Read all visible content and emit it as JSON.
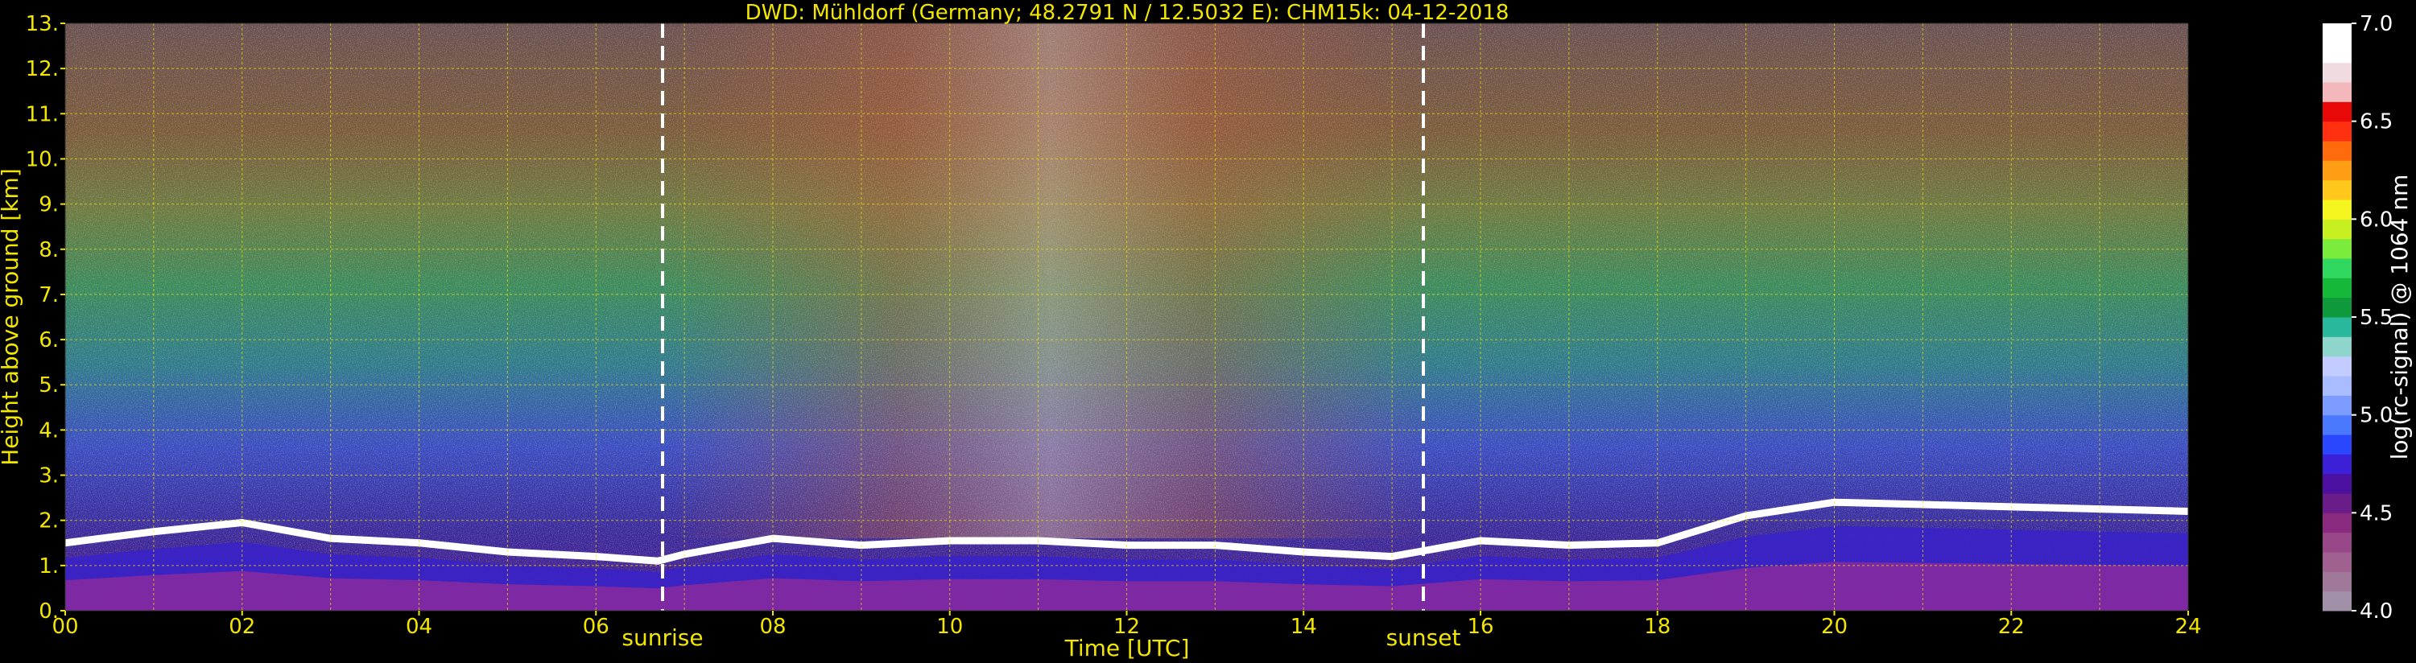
{
  "chart_data": {
    "type": "heatmap",
    "title": "DWD: Mühldorf (Germany; 48.2791 N / 12.5032 E):    CHM15k: 04-12-2018",
    "xlabel": "Time [UTC]",
    "ylabel": "Height above ground [km]",
    "xlim": [
      0,
      24
    ],
    "ylim": [
      0,
      13
    ],
    "x_ticks": [
      "00",
      "02",
      "04",
      "06",
      "08",
      "10",
      "12",
      "14",
      "16",
      "18",
      "20",
      "22",
      "24"
    ],
    "y_ticks": [
      "0.",
      "1.",
      "2.",
      "3.",
      "4.",
      "5.",
      "6.",
      "7.",
      "8.",
      "9.",
      "10.",
      "11.",
      "12.",
      "13."
    ],
    "grid": true,
    "annotations": [
      {
        "label": "sunrise",
        "time": 6.75
      },
      {
        "label": "sunset",
        "time": 15.3
      }
    ],
    "colorbar": {
      "label": "log(rc-signal) @ 1064 nm",
      "range": [
        4.0,
        7.0
      ],
      "ticks": [
        "4.0",
        "4.5",
        "5.0",
        "5.5",
        "6.0",
        "6.5",
        "7.0"
      ],
      "colors": [
        "#a090a8",
        "#a07898",
        "#a06090",
        "#984888",
        "#8a2a7e",
        "#6a1c88",
        "#4c10a0",
        "#3c20d8",
        "#2a46ff",
        "#4a78ff",
        "#7c9cff",
        "#a8bcff",
        "#c2ccff",
        "#8ed6cc",
        "#2ab89c",
        "#0e9a3a",
        "#16b83a",
        "#30d860",
        "#7cec3c",
        "#c8f020",
        "#f4f41e",
        "#ffc81a",
        "#ff9e14",
        "#ff6a0c",
        "#ff3010",
        "#e80808",
        "#f4b8bc",
        "#f0dce0",
        "#ffffff",
        "#ffffff"
      ]
    },
    "cloud_base_top_km": [
      [
        0,
        1.5
      ],
      [
        1,
        1.75
      ],
      [
        2,
        1.95
      ],
      [
        3,
        1.6
      ],
      [
        4,
        1.5
      ],
      [
        5,
        1.3
      ],
      [
        6,
        1.2
      ],
      [
        6.7,
        1.1
      ],
      [
        7,
        1.25
      ],
      [
        8,
        1.6
      ],
      [
        9,
        1.45
      ],
      [
        10,
        1.55
      ],
      [
        11,
        1.55
      ],
      [
        12,
        1.45
      ],
      [
        13,
        1.45
      ],
      [
        14,
        1.3
      ],
      [
        15,
        1.2
      ],
      [
        16,
        1.55
      ],
      [
        17,
        1.45
      ],
      [
        18,
        1.5
      ],
      [
        19,
        2.1
      ],
      [
        20,
        2.4
      ],
      [
        21,
        2.35
      ],
      [
        22,
        2.3
      ],
      [
        23,
        2.25
      ],
      [
        24,
        2.2
      ]
    ]
  }
}
